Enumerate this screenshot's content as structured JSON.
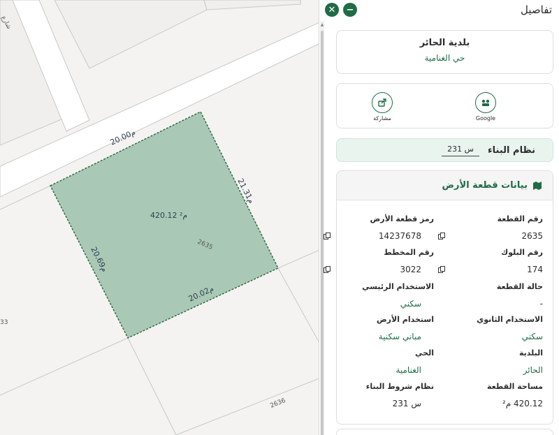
{
  "panel": {
    "title": "تفاصيل",
    "municipality": "بلدية الحائر",
    "district": "حي الغنامية",
    "actions": {
      "google": "Google",
      "share": "مشاركة"
    },
    "building_system": {
      "label": "نظام البناء",
      "value": "س 231"
    },
    "land_data": {
      "title": "بيانات قطعة الأرض",
      "fields": {
        "plot_number": {
          "key": "رقم القطعة",
          "value": "2635"
        },
        "plot_code": {
          "key": "رمز قطعة الأرض",
          "value": "14237678"
        },
        "block_number": {
          "key": "رقم البلوك",
          "value": "174"
        },
        "plan_number": {
          "key": "رقم المخطط",
          "value": "3022"
        },
        "plot_status": {
          "key": "حالة القطعة",
          "value": "-"
        },
        "main_use": {
          "key": "الاستخدام الرئيسي",
          "value": "سكني"
        },
        "secondary_use": {
          "key": "الاستخدام الثانوي",
          "value": "سكني"
        },
        "land_use": {
          "key": "استخدام الأرض",
          "value": "مباني سكنية"
        },
        "municipality": {
          "key": "البلدية",
          "value": "الحائر"
        },
        "district": {
          "key": "الحي",
          "value": "الغنامية"
        },
        "plot_area": {
          "key": "مساحة القطعة",
          "value": "420.12 م²"
        },
        "building_code": {
          "key": "نظام شروط البناء",
          "value": "س 231"
        }
      }
    }
  },
  "map": {
    "street_label": "شارع",
    "area_label": "420.12 م²",
    "plot_label": "2635",
    "edge_top": "20.00م",
    "edge_right": "21.31م",
    "edge_left": "20.69م",
    "edge_bottom": "20.02م",
    "neighbor_label": "2636",
    "edge_num": "33"
  },
  "colors": {
    "accent": "#1f6b46",
    "plot_fill": "#a9c9b6",
    "plot_stroke": "#2e6b45"
  }
}
